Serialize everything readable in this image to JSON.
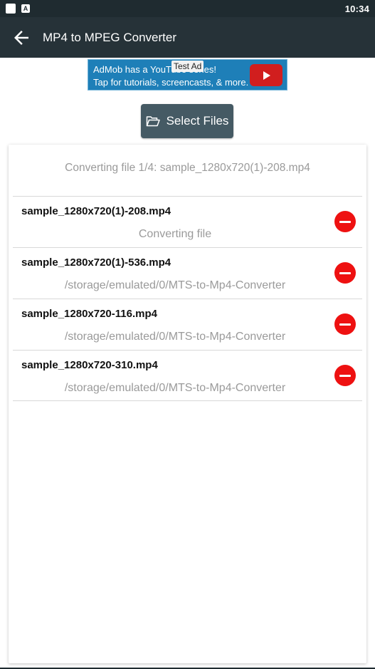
{
  "status_bar": {
    "time": "10:34",
    "notification_icon_letter": "A"
  },
  "app_bar": {
    "title": "MP4 to MPEG Converter"
  },
  "ad": {
    "line1": "AdMob has a YouTube series!",
    "line2": "Tap for tutorials, screencasts, & more.",
    "tag": "Test Ad"
  },
  "select_files": {
    "label": "Select Files"
  },
  "conversion": {
    "status": "Converting file 1/4: sample_1280x720(1)-208.mp4"
  },
  "files": [
    {
      "name": "sample_1280x720(1)-208.mp4",
      "detail": "Converting file"
    },
    {
      "name": "sample_1280x720(1)-536.mp4",
      "detail": "/storage/emulated/0/MTS-to-Mp4-Converter"
    },
    {
      "name": "sample_1280x720-116.mp4",
      "detail": "/storage/emulated/0/MTS-to-Mp4-Converter"
    },
    {
      "name": "sample_1280x720-310.mp4",
      "detail": "/storage/emulated/0/MTS-to-Mp4-Converter"
    }
  ],
  "colors": {
    "app_bar": "#263238",
    "button": "#455a64",
    "remove": "#ee1111"
  }
}
